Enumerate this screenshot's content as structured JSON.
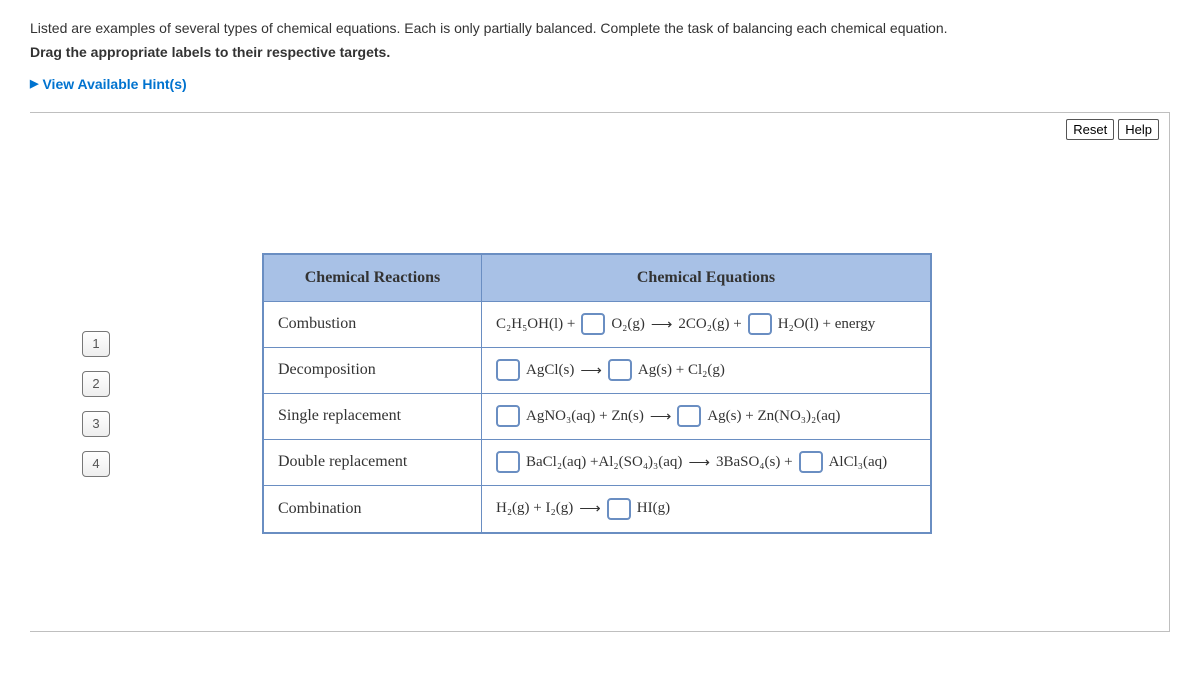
{
  "intro": {
    "line1": "Listed are examples of several types of chemical equations. Each is only partially balanced. Complete the task of balancing each chemical equation.",
    "line2": "Drag the appropriate labels to their respective targets."
  },
  "hints_label": "View Available Hint(s)",
  "buttons": {
    "reset": "Reset",
    "help": "Help"
  },
  "drag_labels": [
    "1",
    "2",
    "3",
    "4"
  ],
  "headers": {
    "reactions": "Chemical Reactions",
    "equations": "Chemical Equations"
  },
  "rows": [
    {
      "reaction": "Combustion",
      "eq": {
        "p0": "C₂H₅OH(l) +",
        "p1": "O₂(g)",
        "p2": "2CO₂(g) +",
        "p3": "H₂O(l) + energy"
      }
    },
    {
      "reaction": "Decomposition",
      "eq": {
        "p0": "AgCl(s)",
        "p1": "Ag(s) + Cl₂(g)"
      }
    },
    {
      "reaction": "Single replacement",
      "eq": {
        "p0": "AgNO₃(aq) + Zn(s)",
        "p1": "Ag(s) + Zn(NO₃)₂(aq)"
      }
    },
    {
      "reaction": "Double replacement",
      "eq": {
        "p0": "BaCl₂(aq) +Al₂(SO₄)₃(aq)",
        "p1": "3BaSO₄(s) +",
        "p2": "AlCl₃(aq)"
      }
    },
    {
      "reaction": "Combination",
      "eq": {
        "p0": "H₂(g) + I₂(g)",
        "p1": "HI(g)"
      }
    }
  ]
}
